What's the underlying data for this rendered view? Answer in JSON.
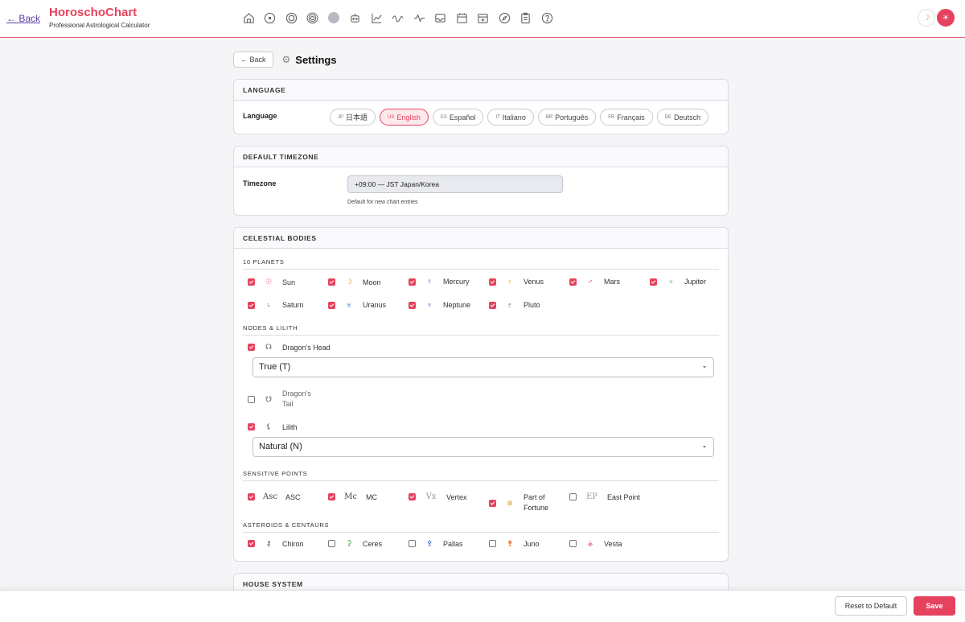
{
  "header": {
    "back_label": "← Back",
    "brand_title": "HoroschoChart",
    "brand_subtitle": "Professional Astrological Calculator",
    "nav_icons": [
      "home-icon",
      "target-icon",
      "circle-icon",
      "concentric-circle-icon",
      "filled-circle-icon",
      "robot-icon",
      "line-chart-icon",
      "wave-icon",
      "activity-icon",
      "inbox-icon",
      "calendar-icon",
      "calendar-add-icon",
      "compass-icon",
      "clipboard-icon",
      "help-icon"
    ],
    "theme_icon": "moon-icon",
    "profile_icon": "sun-icon"
  },
  "page": {
    "back_button": "← Back",
    "title": "Settings",
    "title_icon": "gear-icon"
  },
  "language": {
    "section_title": "LANGUAGE",
    "label": "Language",
    "options": [
      {
        "code": "JP",
        "label": "日本語",
        "active": false
      },
      {
        "code": "US",
        "label": "English",
        "active": true
      },
      {
        "code": "ES",
        "label": "Español",
        "active": false
      },
      {
        "code": "IT",
        "label": "Italiano",
        "active": false
      },
      {
        "code": "BR",
        "label": "Português",
        "active": false
      },
      {
        "code": "FR",
        "label": "Français",
        "active": false
      },
      {
        "code": "DE",
        "label": "Deutsch",
        "active": false
      }
    ]
  },
  "timezone": {
    "section_title": "DEFAULT TIMEZONE",
    "label": "Timezone",
    "value": "+09:00 — JST Japan/Korea",
    "hint": "Default for new chart entries"
  },
  "celestial": {
    "section_title": "CELESTIAL BODIES",
    "planets_title": "10 PLANETS",
    "planets": [
      {
        "label": "Sun",
        "symbol": "☉",
        "color": "#e5425e",
        "checked": true
      },
      {
        "label": "Moon",
        "symbol": "☽",
        "color": "#e0a020",
        "checked": true
      },
      {
        "label": "Mercury",
        "symbol": "☿",
        "color": "#5a6ad8",
        "checked": true
      },
      {
        "label": "Venus",
        "symbol": "♀",
        "color": "#e0a020",
        "checked": true
      },
      {
        "label": "Mars",
        "symbol": "♂",
        "color": "#e5425e",
        "checked": true
      },
      {
        "label": "Jupiter",
        "symbol": "♃",
        "color": "#3aa040",
        "checked": true
      },
      {
        "label": "Saturn",
        "symbol": "♄",
        "color": "#b05020",
        "checked": true
      },
      {
        "label": "Uranus",
        "symbol": "♅",
        "color": "#3060d0",
        "checked": true
      },
      {
        "label": "Neptune",
        "symbol": "♆",
        "color": "#8040c0",
        "checked": true
      },
      {
        "label": "Pluto",
        "symbol": "♇",
        "color": "#333333",
        "checked": true
      }
    ],
    "nodes_title": "NODES & LILITH",
    "dragon_head": {
      "label": "Dragon's Head",
      "symbol": "☊",
      "checked": true,
      "select": "True (T)"
    },
    "dragon_tail": {
      "label_line1": "Dragon's",
      "label_line2": "Tail",
      "symbol": "☋",
      "checked": false
    },
    "lilith": {
      "label": "Lilith",
      "symbol": "⚸",
      "checked": true,
      "select": "Natural (N)"
    },
    "sensitive_title": "SENSITIVE POINTS",
    "sensitive": [
      {
        "label": "ASC",
        "symbol": "Asc",
        "color": "#444444",
        "checked": true
      },
      {
        "label": "MC",
        "symbol": "Mc",
        "color": "#444444",
        "checked": true
      },
      {
        "label": "Vertex",
        "symbol": "Vx",
        "color": "#999999",
        "checked": true
      },
      {
        "label_line1": "Part of",
        "label_line2": "Fortune",
        "symbol": "⊗",
        "color": "#e0a020",
        "checked": true
      },
      {
        "label": "East Point",
        "symbol": "EP",
        "color": "#999999",
        "checked": false
      }
    ],
    "asteroids_title": "ASTEROIDS & CENTAURS",
    "asteroids": [
      {
        "label": "Chiron",
        "symbol": "⚷",
        "color": "#555555",
        "checked": true
      },
      {
        "label": "Ceres",
        "symbol": "⚳",
        "color": "#3aa040",
        "checked": false
      },
      {
        "label": "Pallas",
        "symbol": "⚴",
        "color": "#3060d0",
        "checked": false
      },
      {
        "label": "Juno",
        "symbol": "⚵",
        "color": "#e07020",
        "checked": false
      },
      {
        "label": "Vesta",
        "symbol": "⚶",
        "color": "#e5425e",
        "checked": false
      }
    ]
  },
  "house": {
    "section_title": "HOUSE SYSTEM"
  },
  "footer": {
    "reset_label": "Reset to Default",
    "save_label": "Save"
  },
  "colors": {
    "accent": "#e5425e",
    "brand_link": "#5b3fa8"
  }
}
